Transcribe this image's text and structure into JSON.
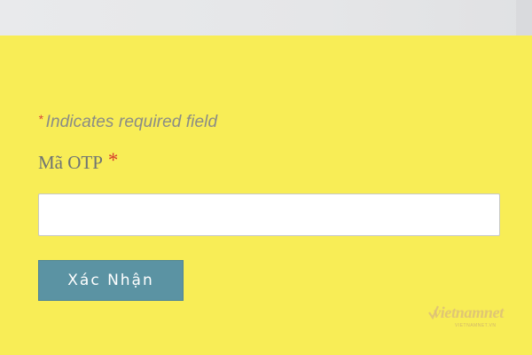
{
  "form": {
    "required_star": "*",
    "required_note": "Indicates required field",
    "otp_label": "Mã OTP",
    "otp_required_star": "*",
    "otp_value": "",
    "otp_placeholder": "",
    "submit_label": "Xác Nhận"
  },
  "watermark": {
    "brand": "vietnamnet",
    "domain": "VIETNAMNET.VN"
  },
  "colors": {
    "panel_background": "#f8ed56",
    "button": "#5b93a3",
    "required_star": "#d63b2e"
  }
}
